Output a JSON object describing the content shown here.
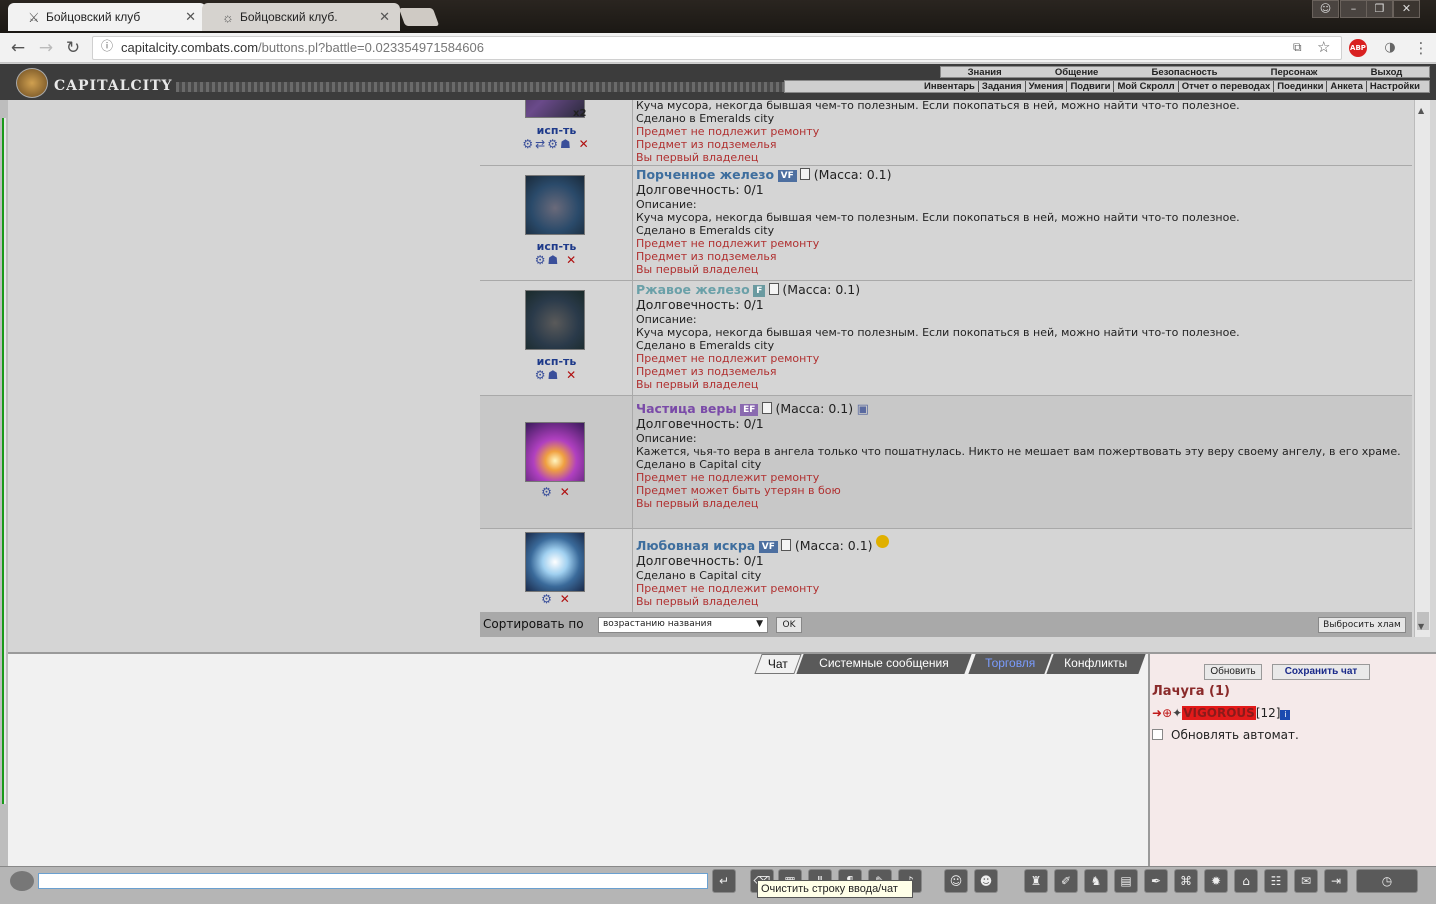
{
  "browser": {
    "tabs": [
      {
        "title": "Бойцовский клуб",
        "active": true
      },
      {
        "title": "Бойцовский клуб.",
        "active": false
      }
    ],
    "url_host": "capitalcity.combats.com",
    "url_path": "/buttons.pl?battle=0.023354971584606",
    "abp_label": "ABP"
  },
  "game": {
    "logo_text": "CAPITALCITY",
    "menu_top": [
      "Знания",
      "Общение",
      "Безопасность",
      "Персонаж",
      "Выход"
    ],
    "menu_sub": [
      "Инвентарь",
      "Задания",
      "Умения",
      "Подвиги",
      "Мой Скролл",
      "Отчет о переводах",
      "Поединки",
      "Анкета",
      "Настройки"
    ]
  },
  "items": [
    {
      "use_label": "исп-ть",
      "qty": "x2",
      "desc": "Куча мусора, некогда бывшая чем-то полезным. Если покопаться в ней, можно найти что-то полезное.",
      "made": "Сделано в Emeralds city",
      "notes": [
        "Предмет не подлежит ремонту",
        "Предмет из подземелья",
        "Вы первый владелец"
      ]
    },
    {
      "name": "Порченное железо",
      "badge": "VF",
      "mass": "(Масса: 0.1)",
      "durability": "Долговечность: 0/1",
      "desc_label": "Описание:",
      "desc": "Куча мусора, некогда бывшая чем-то полезным. Если покопаться в ней, можно найти что-то полезное.",
      "made": "Сделано в Emeralds city",
      "notes": [
        "Предмет не подлежит ремонту",
        "Предмет из подземелья",
        "Вы первый владелец"
      ],
      "use_label": "исп-ть"
    },
    {
      "name": "Ржавое железо",
      "badge": "F",
      "mass": "(Масса: 0.1)",
      "durability": "Долговечность: 0/1",
      "desc_label": "Описание:",
      "desc": "Куча мусора, некогда бывшая чем-то полезным. Если покопаться в ней, можно найти что-то полезное.",
      "made": "Сделано в Emeralds city",
      "notes": [
        "Предмет не подлежит ремонту",
        "Предмет из подземелья",
        "Вы первый владелец"
      ],
      "use_label": "исп-ть"
    },
    {
      "name": "Частица веры",
      "badge": "EF",
      "mass": "(Масса: 0.1)",
      "durability": "Долговечность: 0/1",
      "desc_label": "Описание:",
      "desc": "Кажется, чья-то вера в ангела только что пошатнулась. Никто не мешает вам пожертвовать эту веру своему ангелу, в его храме.",
      "made": "Сделано в Capital city",
      "notes": [
        "Предмет не подлежит ремонту",
        "Предмет может быть утерян в бою",
        "Вы первый владелец"
      ]
    },
    {
      "name": "Любовная искра",
      "badge": "VF",
      "mass": "(Масса: 0.1)",
      "durability": "Долговечность: 0/1",
      "made": "Сделано в Capital city",
      "notes": [
        "Предмет не подлежит ремонту",
        "Вы первый владелец"
      ]
    }
  ],
  "sort": {
    "label": "Сортировать по",
    "selected": "возрастанию названия",
    "ok": "OK",
    "discard": "Выбросить хлам"
  },
  "chat": {
    "tabs": [
      "Чат",
      "Системные сообщения",
      "Торговля",
      "Конфликты"
    ],
    "refresh": "Обновить",
    "save": "Сохранить чат",
    "room": "Лачуга (1)",
    "user_name": "VIGOROUS",
    "user_level": "[12]",
    "info_glyph": "i",
    "auto_refresh": "Обновлять автомат.",
    "tooltip": "Очистить строку ввода/чат"
  },
  "colors": {
    "item_name_blue": "#3e6e9e",
    "item_name_teal": "#6aa0a8",
    "item_name_purple": "#7a4aa8",
    "note_red": "#b03030"
  }
}
